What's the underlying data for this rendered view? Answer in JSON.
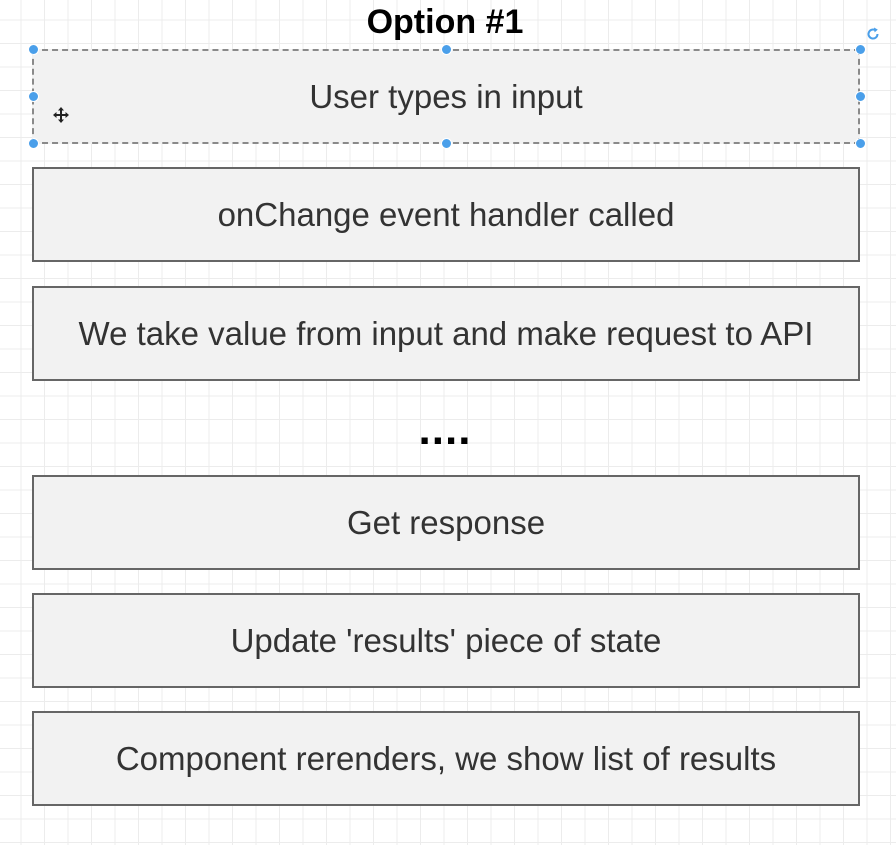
{
  "diagram": {
    "title": "Option #1",
    "steps": [
      "User types in input",
      "onChange event handler called",
      "We take value from input and make request to API",
      "Get response",
      "Update 'results' piece of state",
      "Component rerenders, we show list of results"
    ],
    "ellipsis": "....",
    "colors": {
      "box_fill": "#f2f2f2",
      "box_border": "#666666",
      "selection_handle": "#4a9fea",
      "grid": "#ececec"
    },
    "icons": {
      "rotate": "rotate-icon",
      "move": "move-cursor-icon"
    }
  }
}
